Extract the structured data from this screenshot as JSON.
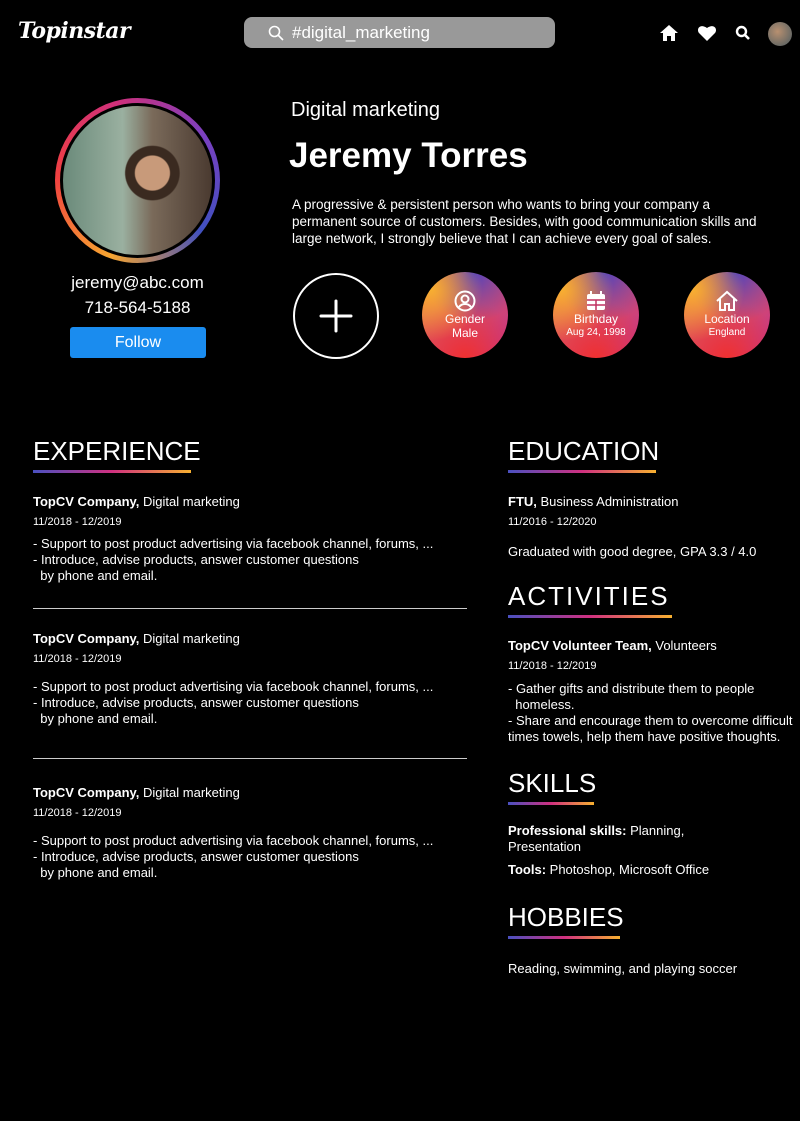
{
  "header": {
    "logo": "Topinstar",
    "search_value": "#digital_marketing"
  },
  "profile": {
    "email": "jeremy@abc.com",
    "phone": "718-564-5188",
    "follow_label": "Follow",
    "role": "Digital marketing",
    "name": "Jeremy Torres",
    "description": "A progressive & persistent person who wants to bring your company a permanent source of customers. Besides, with good communication skills and large network, I strongly believe that I can achieve every goal of sales."
  },
  "info": [
    {
      "label": "Gender",
      "value": "Male"
    },
    {
      "label": "Birthday",
      "value": "Aug 24, 1998"
    },
    {
      "label": "Location",
      "value": "England"
    }
  ],
  "experience": {
    "title": "EXPERIENCE",
    "items": [
      {
        "company": "TopCV Company,",
        "role": " Digital marketing",
        "date": "11/2018 - 12/2019",
        "lines": [
          "- Support to post product advertising via facebook channel, forums, ...",
          "- Introduce, advise products, answer customer questions",
          "  by phone and email."
        ]
      },
      {
        "company": "TopCV Company,",
        "role": " Digital marketing",
        "date": "11/2018 - 12/2019",
        "lines": [
          "- Support to post product advertising via facebook channel, forums, ...",
          "- Introduce, advise products, answer customer questions",
          "  by phone and email."
        ]
      },
      {
        "company": "TopCV Company,",
        "role": " Digital marketing",
        "date": "11/2018 - 12/2019",
        "lines": [
          "- Support to post product advertising via facebook channel, forums, ...",
          "- Introduce, advise products, answer customer questions",
          "  by phone and email."
        ]
      }
    ]
  },
  "education": {
    "title": "EDUCATION",
    "school": "FTU,",
    "major": " Business Administration",
    "date": "11/2016 - 12/2020",
    "note": "Graduated with good degree, GPA 3.3 / 4.0"
  },
  "activities": {
    "title": "ACTIVITIES",
    "org": "TopCV Volunteer Team,",
    "role": " Volunteers",
    "date": "11/2018 - 12/2019",
    "lines": [
      "- Gather gifts and distribute them to people",
      "  homeless.",
      "- Share and encourage them to overcome difficult",
      "times towels, help them have positive thoughts."
    ]
  },
  "skills": {
    "title": "SKILLS",
    "pro_label": "Professional skills:",
    "pro_value": " Planning,",
    "pro_value2": "Presentation",
    "tools_label": "Tools:",
    "tools_value": " Photoshop, Microsoft Office"
  },
  "hobbies": {
    "title": "HOBBIES",
    "text": "Reading, swimming, and playing soccer"
  }
}
